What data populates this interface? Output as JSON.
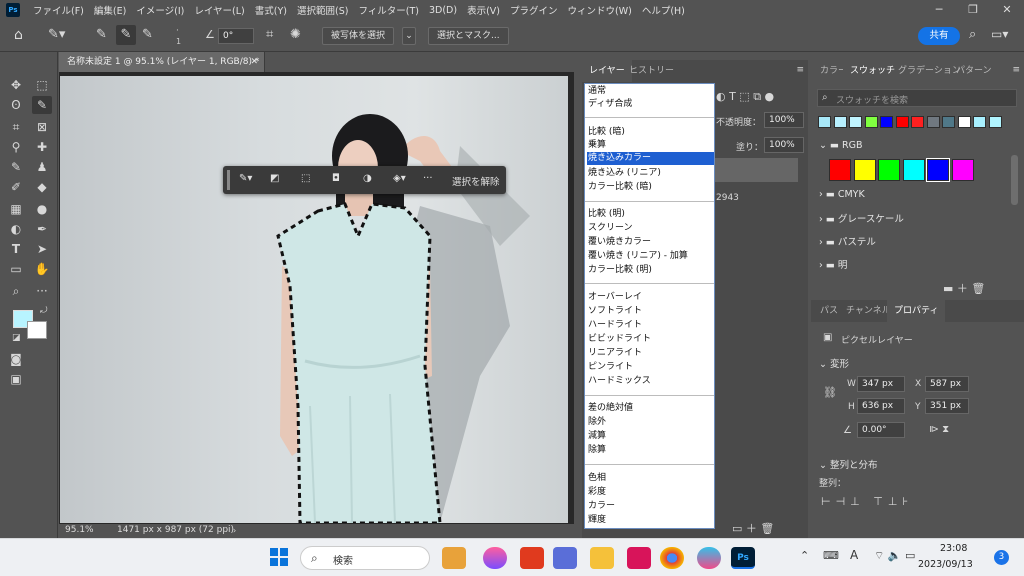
{
  "app": {
    "menus": [
      "ファイル(F)",
      "編集(E)",
      "イメージ(I)",
      "レイヤー(L)",
      "書式(Y)",
      "選択範囲(S)",
      "フィルター(T)",
      "3D(D)",
      "表示(V)",
      "プラグイン",
      "ウィンドウ(W)",
      "ヘルプ(H)"
    ]
  },
  "options": {
    "size": "1",
    "angle": "0°",
    "subject_select": "被写体を選択",
    "select_mask": "選択とマスク...",
    "share": "共有"
  },
  "document": {
    "tab_title": "名称未設定 1 @ 95.1% (レイヤー 1, RGB/8) *",
    "zoom": "95.1%",
    "info": "1471 px x 987 px (72 ppi)"
  },
  "context_bar": {
    "deselect": "選択を解除",
    "more": "···"
  },
  "layers": {
    "tabs": [
      "レイヤー",
      "ヒストリー"
    ],
    "opacity_label": "不透明度：",
    "opacity": "100%",
    "fill_label": "塗り：",
    "fill": "100%",
    "layer_value": "2943"
  },
  "blend_modes": {
    "selected": "焼き込みカラー",
    "groups": [
      [
        "通常",
        "ディザ合成"
      ],
      [
        "比較 (暗)",
        "乗算",
        "焼き込みカラー",
        "焼き込み (リニア)",
        "カラー比較 (暗)"
      ],
      [
        "比較 (明)",
        "スクリーン",
        "覆い焼きカラー",
        "覆い焼き (リニア) - 加算",
        "カラー比較 (明)"
      ],
      [
        "オーバーレイ",
        "ソフトライト",
        "ハードライト",
        "ビビッドライト",
        "リニアライト",
        "ピンライト",
        "ハードミックス"
      ],
      [
        "差の絶対値",
        "除外",
        "減算",
        "除算"
      ],
      [
        "色相",
        "彩度",
        "カラー",
        "輝度"
      ]
    ]
  },
  "swatches": {
    "tabs": [
      "カラー",
      "スウォッチ",
      "グラデーション",
      "パターン"
    ],
    "search_placeholder": "スウォッチを検索",
    "recent": [
      "#a8e8f8",
      "#b8f0ff",
      "#c0f4ff",
      "#80ff40",
      "#0000ff",
      "#ff0000",
      "#ff2020",
      "#707880",
      "#507888",
      "#ffffff",
      "#a8f0ff",
      "#b0f4ff"
    ],
    "rgb_folder": "RGB",
    "rgb_colors": [
      "#ff0000",
      "#ffff00",
      "#00ff00",
      "#00ffff",
      "#0000ff",
      "#ff00ff"
    ],
    "folders": [
      "CMYK",
      "グレースケール",
      "パステル",
      "明"
    ]
  },
  "properties": {
    "tabs": [
      "パス",
      "チャンネル",
      "プロパティ"
    ],
    "layer_type": "ピクセルレイヤー",
    "transform_label": "変形",
    "W": "347 px",
    "H": "636 px",
    "X": "587 px",
    "Y": "351 px",
    "angle": "0.00°",
    "align_label": "整列と分布",
    "align_sub": "整列："
  },
  "taskbar": {
    "search": "検索",
    "time": "23:08",
    "date": "2023/09/13",
    "notif": "3",
    "ime": "A"
  }
}
